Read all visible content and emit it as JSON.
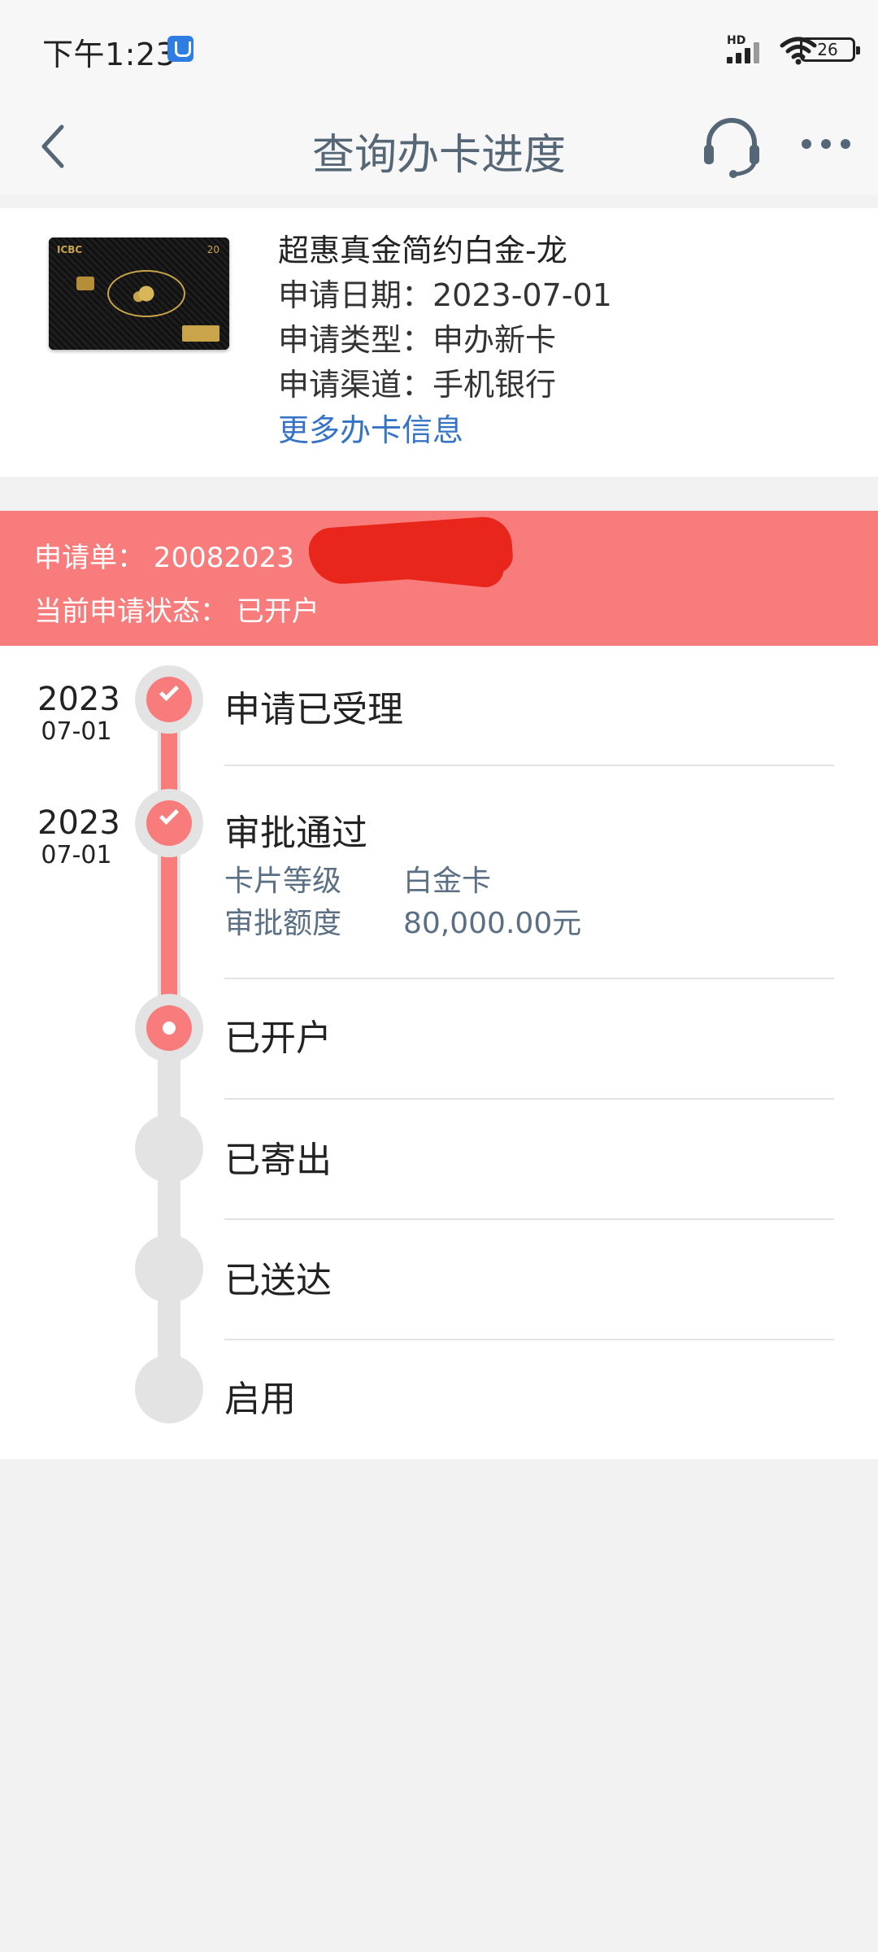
{
  "status_bar": {
    "time": "下午1:23",
    "signal_label": "HD",
    "battery": "26"
  },
  "nav": {
    "title": "查询办卡进度"
  },
  "card": {
    "name": "超惠真金简约白金-龙",
    "apply_date": "申请日期：2023-07-01",
    "apply_type": "申请类型：申办新卡",
    "apply_channel": "申请渠道：手机银行",
    "more_link": "更多办卡信息",
    "image_text": {
      "logo": "ICBC",
      "number": "20"
    }
  },
  "banner": {
    "order": "申请单： 20082023",
    "status": "当前申请状态：  已开户"
  },
  "timeline": {
    "steps": [
      {
        "label": "申请已受理",
        "year": "2023",
        "date": "07-01",
        "state": "done"
      },
      {
        "label": "审批通过",
        "year": "2023",
        "date": "07-01",
        "state": "done"
      },
      {
        "label": "已开户",
        "year": "",
        "date": "",
        "state": "current"
      },
      {
        "label": "已寄出",
        "year": "",
        "date": "",
        "state": "pending"
      },
      {
        "label": "已送达",
        "year": "",
        "date": "",
        "state": "pending"
      },
      {
        "label": "启用",
        "year": "",
        "date": "",
        "state": "pending"
      }
    ],
    "approval": {
      "level_key": "卡片等级",
      "level_value": "白金卡",
      "limit_key": "审批额度",
      "limit_value": "80,000.00元"
    }
  },
  "colors": {
    "accent": "#f87c7c",
    "link": "#3573c7",
    "title": "#556677",
    "redact": "#e8261c"
  },
  "icons": [
    "back-chevron-icon",
    "customer-service-headset-icon",
    "more-dots-icon",
    "check-icon",
    "current-dot-icon"
  ]
}
